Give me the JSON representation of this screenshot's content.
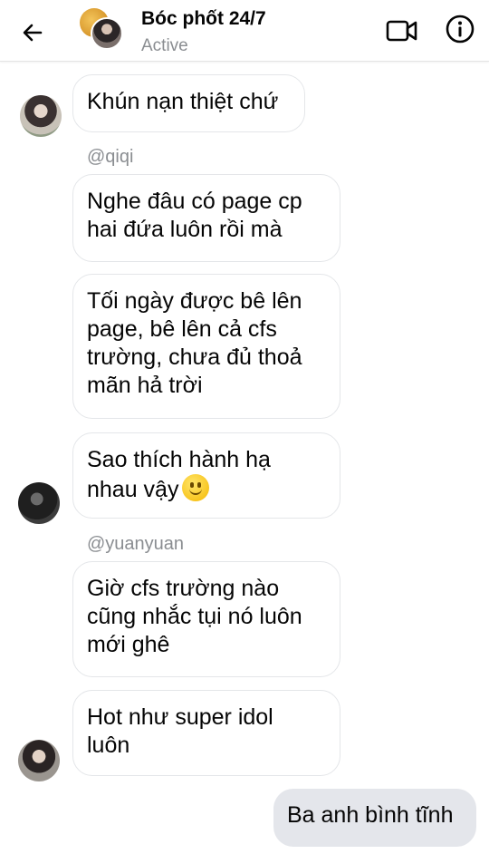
{
  "header": {
    "title": "Bóc phốt 24/7",
    "status": "Active"
  },
  "messages": [
    {
      "text": "Khún nạn thiệt chứ"
    },
    {
      "mention": "@qiqi"
    },
    {
      "text": "Nghe đâu có page cp\nhai đứa luôn rồi mà"
    },
    {
      "text": "Tối ngày được bê lên\npage, bê lên cả cfs\ntrường, chưa đủ thoả\nmãn hả trời"
    },
    {
      "text": "Sao thích hành hạ\nnhau vậy"
    },
    {
      "mention": "@yuanyuan"
    },
    {
      "text": "Giờ cfs trường nào\ncũng nhắc tụi nó luôn\nmới ghê"
    },
    {
      "text": "Hot như super idol\nluôn"
    },
    {
      "text": "Ba anh bình tĩnh"
    }
  ],
  "icons": {
    "back": "back-arrow-icon",
    "video": "video-camera-icon",
    "info": "info-icon",
    "emoji": "slightly-smiling-face-icon"
  }
}
